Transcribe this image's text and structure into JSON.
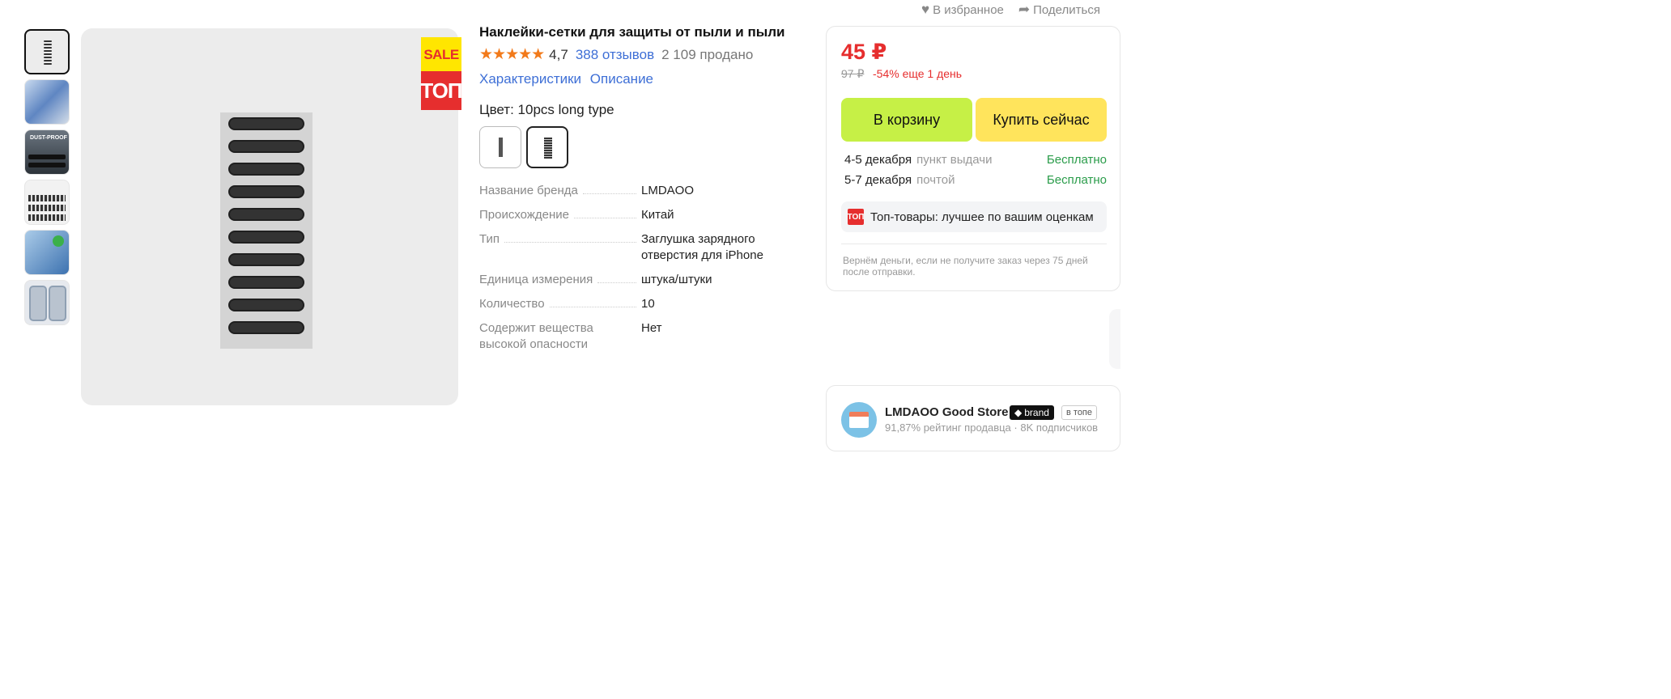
{
  "product": {
    "title": "Наклейки-сетки для защиты от пыли и пыли",
    "stars": "★★★★★",
    "rating": "4,7",
    "reviews": "388 отзывов",
    "sold": "2 109 продано",
    "links": {
      "specs": "Характеристики",
      "description": "Описание"
    },
    "color_label": "Цвет: 10pcs long type"
  },
  "badges": {
    "sale": "SALE",
    "top": "ТОП"
  },
  "specs": [
    {
      "name": "Название бренда",
      "value": "LMDAOO"
    },
    {
      "name": "Происхождение",
      "value": "Китай"
    },
    {
      "name": "Тип",
      "value": "Заглушка зарядного отверстия для iPhone"
    },
    {
      "name": "Единица измерения",
      "value": "штука/штуки"
    },
    {
      "name": "Количество",
      "value": "10"
    },
    {
      "name": "Содержит вещества высокой опасности",
      "value": "Нет"
    }
  ],
  "top_actions": {
    "favorite": "В избранное",
    "share": "Поделиться"
  },
  "buybox": {
    "price": "45 ₽",
    "old_price": "97 ₽",
    "discount": "-54% еще 1 день",
    "cart_button": "В корзину",
    "buy_button": "Купить сейчас",
    "delivery": [
      {
        "date": "4-5 декабря",
        "method": "пункт выдачи",
        "cost": "Бесплатно"
      },
      {
        "date": "5-7 декабря",
        "method": "почтой",
        "cost": "Бесплатно"
      }
    ],
    "promo_icon": "ТОП",
    "promo": "Топ-товары: лучшее по вашим оценкам",
    "guarantee": "Вернём деньги, если не получите заказ через 75 дней после отправки."
  },
  "store": {
    "name": "LMDAOO Good Store",
    "brand_badge": "brand",
    "top_badge": "в топе",
    "meta": "91,87% рейтинг продавца · 8K подписчиков"
  },
  "colors": {
    "price": "#e62e2e",
    "cart": "#c6f046",
    "buy": "#ffe45c",
    "link": "#3e6fd6",
    "free": "#2a9c4a"
  }
}
